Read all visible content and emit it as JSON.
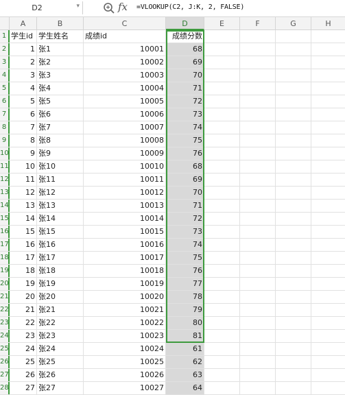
{
  "formula_bar": {
    "name_box": "D2",
    "formula": "=VLOOKUP(C2, J:K, 2, FALSE)",
    "zoom_icon": "magnifier-zoom-icon",
    "fx_label": "fx"
  },
  "columns": [
    "A",
    "B",
    "C",
    "D",
    "E",
    "F",
    "G",
    "H"
  ],
  "header_row": {
    "row_num": "1",
    "a": "学生id",
    "b": "学生姓名",
    "c": "成绩id",
    "d": "成绩分数"
  },
  "rows": [
    {
      "n": "2",
      "a": "1",
      "b": "张1",
      "c": "10001",
      "d": "68"
    },
    {
      "n": "3",
      "a": "2",
      "b": "张2",
      "c": "10002",
      "d": "69"
    },
    {
      "n": "4",
      "a": "3",
      "b": "张3",
      "c": "10003",
      "d": "70"
    },
    {
      "n": "5",
      "a": "4",
      "b": "张4",
      "c": "10004",
      "d": "71"
    },
    {
      "n": "6",
      "a": "5",
      "b": "张5",
      "c": "10005",
      "d": "72"
    },
    {
      "n": "7",
      "a": "6",
      "b": "张6",
      "c": "10006",
      "d": "73"
    },
    {
      "n": "8",
      "a": "7",
      "b": "张7",
      "c": "10007",
      "d": "74"
    },
    {
      "n": "9",
      "a": "8",
      "b": "张8",
      "c": "10008",
      "d": "75"
    },
    {
      "n": "10",
      "a": "9",
      "b": "张9",
      "c": "10009",
      "d": "76"
    },
    {
      "n": "11",
      "a": "10",
      "b": "张10",
      "c": "10010",
      "d": "68"
    },
    {
      "n": "12",
      "a": "11",
      "b": "张11",
      "c": "10011",
      "d": "69"
    },
    {
      "n": "13",
      "a": "12",
      "b": "张12",
      "c": "10012",
      "d": "70"
    },
    {
      "n": "14",
      "a": "13",
      "b": "张13",
      "c": "10013",
      "d": "71"
    },
    {
      "n": "15",
      "a": "14",
      "b": "张14",
      "c": "10014",
      "d": "72"
    },
    {
      "n": "16",
      "a": "15",
      "b": "张15",
      "c": "10015",
      "d": "73"
    },
    {
      "n": "17",
      "a": "16",
      "b": "张16",
      "c": "10016",
      "d": "74"
    },
    {
      "n": "18",
      "a": "17",
      "b": "张17",
      "c": "10017",
      "d": "75"
    },
    {
      "n": "19",
      "a": "18",
      "b": "张18",
      "c": "10018",
      "d": "76"
    },
    {
      "n": "20",
      "a": "19",
      "b": "张19",
      "c": "10019",
      "d": "77"
    },
    {
      "n": "21",
      "a": "20",
      "b": "张20",
      "c": "10020",
      "d": "78"
    },
    {
      "n": "22",
      "a": "21",
      "b": "张21",
      "c": "10021",
      "d": "79"
    },
    {
      "n": "23",
      "a": "22",
      "b": "张22",
      "c": "10022",
      "d": "80"
    },
    {
      "n": "24",
      "a": "23",
      "b": "张23",
      "c": "10023",
      "d": "81"
    },
    {
      "n": "25",
      "a": "24",
      "b": "张24",
      "c": "10024",
      "d": "61"
    },
    {
      "n": "26",
      "a": "25",
      "b": "张25",
      "c": "10025",
      "d": "62"
    },
    {
      "n": "27",
      "a": "26",
      "b": "张26",
      "c": "10026",
      "d": "63"
    },
    {
      "n": "28",
      "a": "27",
      "b": "张27",
      "c": "10027",
      "d": "64"
    }
  ],
  "colors": {
    "selection": "#3d9a3d",
    "selected_column_fill": "#d9d9d9"
  }
}
